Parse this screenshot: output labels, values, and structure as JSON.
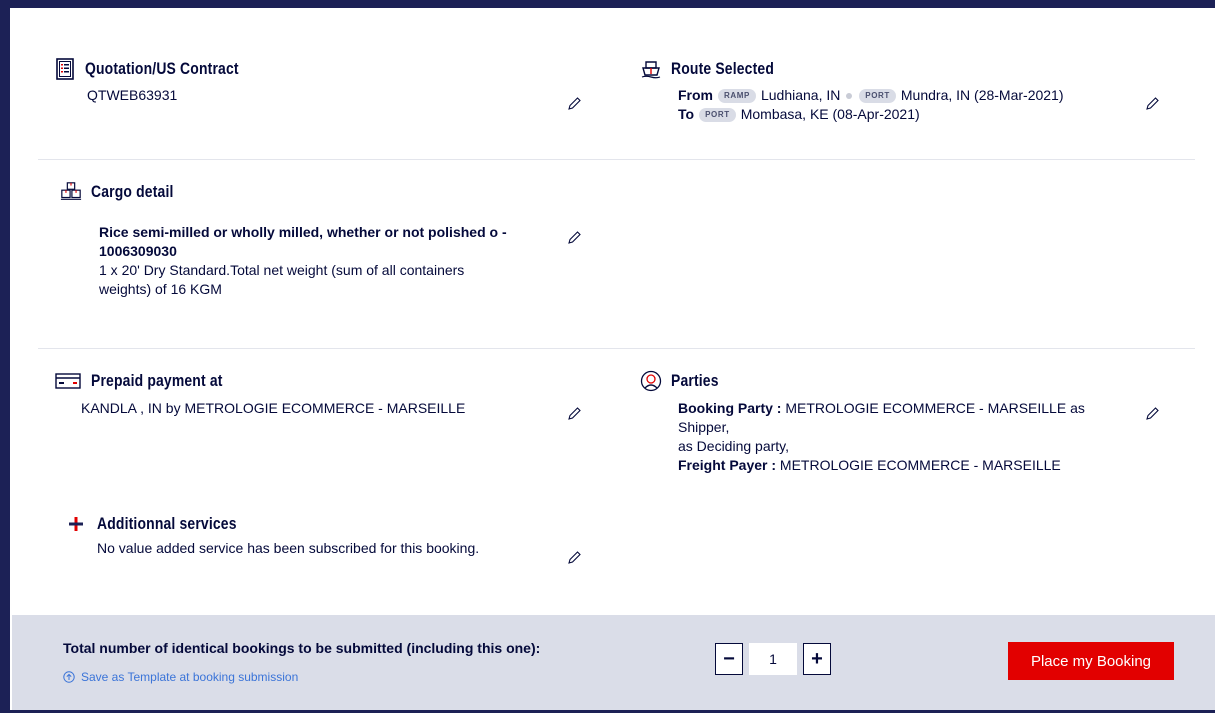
{
  "quotation": {
    "title": "Quotation/US Contract",
    "value": "QTWEB63931"
  },
  "route": {
    "title": "Route Selected",
    "from_label": "From",
    "from_tag1": "RAMP",
    "from_place1": "Ludhiana, IN",
    "from_tag2": "PORT",
    "from_place2": "Mundra, IN (28-Mar-2021)",
    "to_label": "To",
    "to_tag": "PORT",
    "to_place": "Mombasa, KE (08-Apr-2021)"
  },
  "cargo": {
    "title": "Cargo detail",
    "commodity": "Rice semi-milled or wholly milled, whether or not polished o - 1006309030",
    "description": "1 x 20' Dry Standard.Total net weight (sum of all containers weights) of 16 KGM"
  },
  "payment": {
    "title": "Prepaid payment at",
    "value": "KANDLA , IN by METROLOGIE ECOMMERCE - MARSEILLE"
  },
  "parties": {
    "title": "Parties",
    "booking_label": "Booking Party :",
    "booking_value": "METROLOGIE ECOMMERCE - MARSEILLE as",
    "line2": "Shipper,",
    "line3": "as Deciding party,",
    "freight_label": "Freight Payer :",
    "freight_value": "METROLOGIE ECOMMERCE - MARSEILLE"
  },
  "services": {
    "title": "Additionnal services",
    "value": "No value added service has been subscribed for this booking."
  },
  "footer": {
    "label": "Total number of identical bookings to be submitted (including this one):",
    "template_link": "Save as Template at booking submission",
    "minus": "−",
    "plus": "+",
    "quantity": "1",
    "place_button": "Place my Booking"
  },
  "icons": {
    "quotation": "document-list-icon",
    "route": "ship-icon",
    "cargo": "cargo-boxes-icon",
    "payment": "credit-card-icon",
    "parties": "person-circle-icon",
    "services": "plus-icon",
    "edit": "pencil-icon"
  },
  "colors": {
    "navy": "#04093a",
    "accent_red": "#e20000",
    "link_blue": "#3b74d8",
    "footer_bg": "#dadde8"
  }
}
